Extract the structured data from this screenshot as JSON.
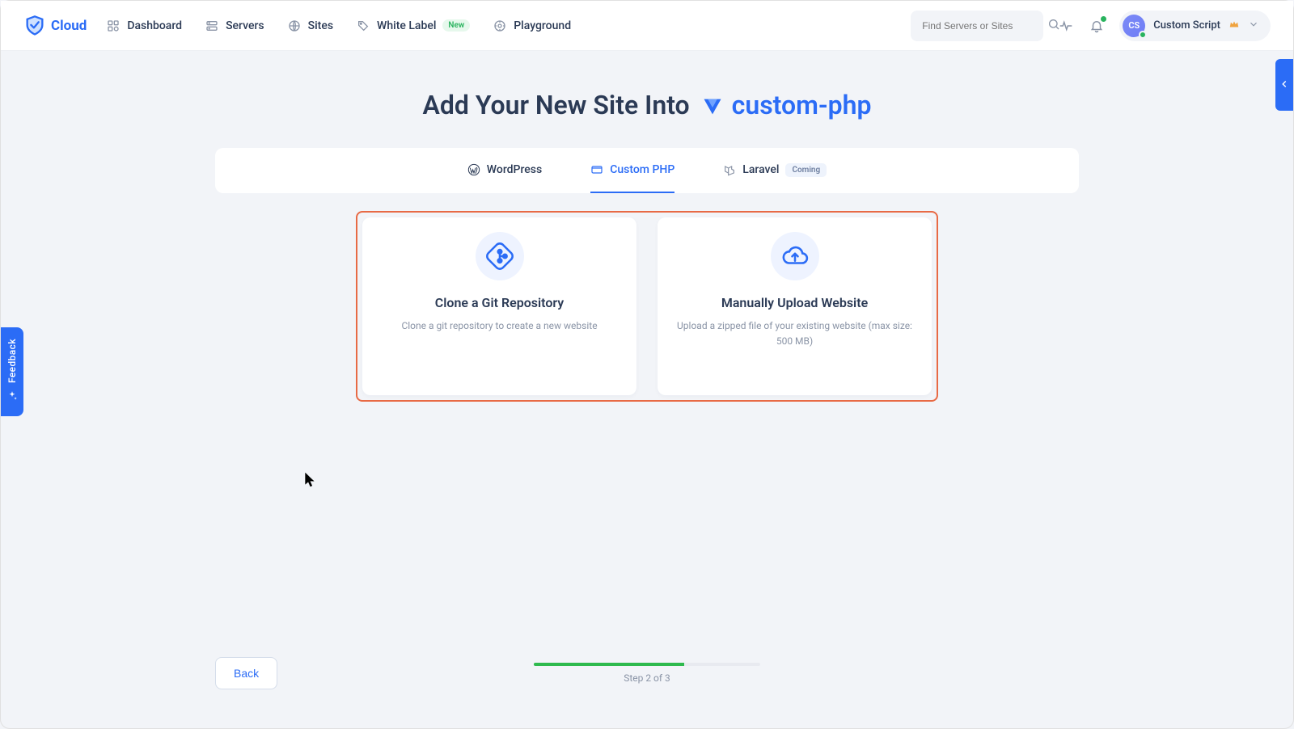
{
  "brand": {
    "name": "Cloud"
  },
  "nav": {
    "dashboard": "Dashboard",
    "servers": "Servers",
    "sites": "Sites",
    "white_label": "White Label",
    "white_label_badge": "New",
    "playground": "Playground"
  },
  "search": {
    "placeholder": "Find Servers or Sites"
  },
  "profile": {
    "avatar_initials": "CS",
    "name": "Custom Script"
  },
  "feedback_label": "Feedback",
  "page": {
    "title_prefix": "Add Your New Site Into",
    "server_name": "custom-php"
  },
  "tabs": {
    "wordpress": "WordPress",
    "custom_php": "Custom PHP",
    "laravel": "Laravel",
    "coming": "Coming"
  },
  "options": {
    "git": {
      "title": "Clone a Git Repository",
      "desc": "Clone a git repository to create a new website"
    },
    "upload": {
      "title": "Manually Upload Website",
      "desc": "Upload a zipped file of your existing website (max size: 500 MB)"
    }
  },
  "footer": {
    "back": "Back",
    "step_text": "Step 2 of 3"
  }
}
